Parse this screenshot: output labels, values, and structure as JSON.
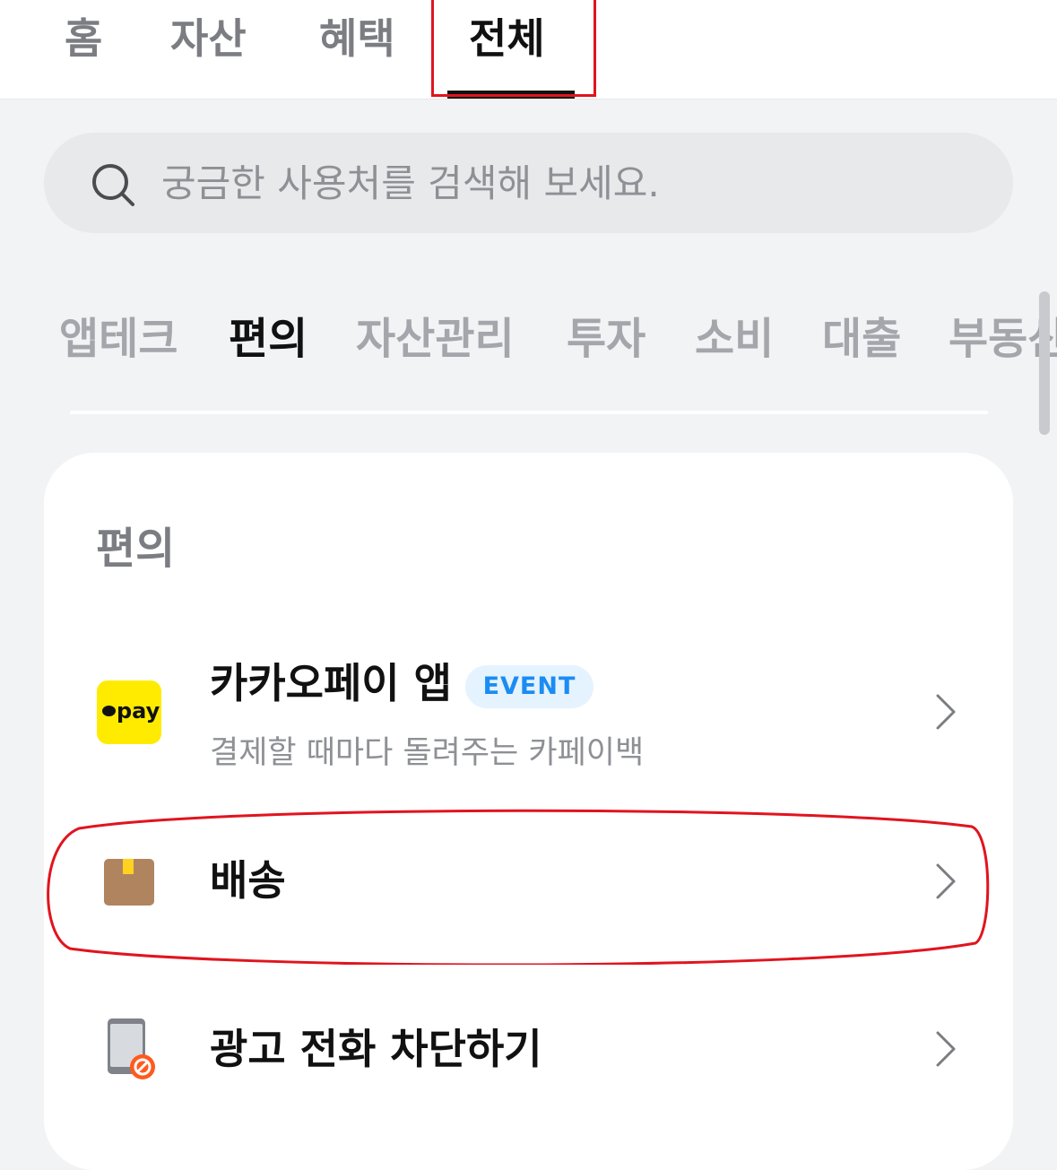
{
  "top_tabs": [
    {
      "label": "홈"
    },
    {
      "label": "자산"
    },
    {
      "label": "혜택"
    },
    {
      "label": "전체"
    }
  ],
  "active_top_tab": "전체",
  "search": {
    "placeholder": "궁금한 사용처를 검색해 보세요.",
    "icon": "search-icon"
  },
  "categories": [
    {
      "label": "앱테크"
    },
    {
      "label": "편의"
    },
    {
      "label": "자산관리"
    },
    {
      "label": "투자"
    },
    {
      "label": "소비"
    },
    {
      "label": "대출"
    },
    {
      "label": "부동산"
    }
  ],
  "active_category": "편의",
  "section": {
    "title": "편의",
    "items": [
      {
        "title": "카카오페이 앱",
        "badge": "EVENT",
        "subtitle": "결제할 때마다 돌려주는 카페이백",
        "icon": "pay-icon",
        "icon_text": "pay"
      },
      {
        "title": "배송",
        "icon": "package-icon"
      },
      {
        "title": "광고 전화 차단하기",
        "icon": "blocked-phone-icon"
      }
    ]
  },
  "colors": {
    "background": "#f2f3f5",
    "accent_badge_bg": "#e5f3ff",
    "accent_badge_text": "#1b8cf2",
    "kakaopay_yellow": "#ffeb00",
    "annotation_red": "#e1141e"
  }
}
